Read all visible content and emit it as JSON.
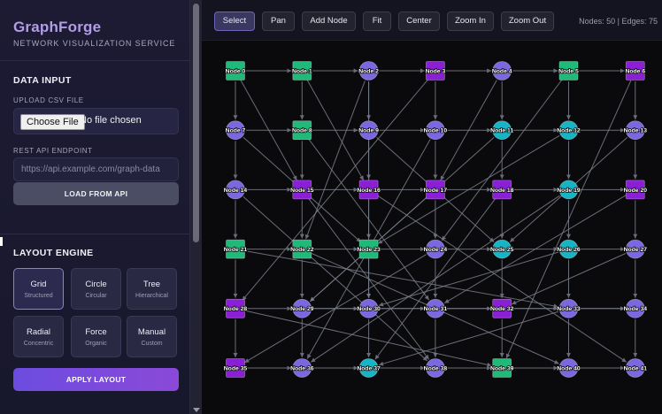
{
  "sidebar": {
    "brand": "GraphForge",
    "subtitle": "NETWORK VISUALIZATION SERVICE",
    "data_input": {
      "title": "DATA INPUT",
      "upload_label": "UPLOAD CSV FILE",
      "file_button": "Choose File",
      "file_status": "No file chosen",
      "api_label": "REST API ENDPOINT",
      "api_placeholder": "https://api.example.com/graph-data",
      "load_button": "LOAD FROM API"
    },
    "layout_engine": {
      "title": "LAYOUT ENGINE",
      "options": [
        {
          "name": "Grid",
          "sub": "Structured",
          "active": true
        },
        {
          "name": "Circle",
          "sub": "Circular",
          "active": false
        },
        {
          "name": "Tree",
          "sub": "Hierarchical",
          "active": false
        },
        {
          "name": "Radial",
          "sub": "Concentric",
          "active": false
        },
        {
          "name": "Force",
          "sub": "Organic",
          "active": false
        },
        {
          "name": "Manual",
          "sub": "Custom",
          "active": false
        }
      ],
      "apply_button": "APPLY LAYOUT"
    }
  },
  "toolbar": {
    "buttons": [
      "Select",
      "Pan",
      "Add Node",
      "Fit",
      "Center",
      "Zoom In",
      "Zoom Out"
    ],
    "active": "Select",
    "stats": "Nodes: 50 | Edges: 75"
  },
  "colors": {
    "circle_purple": "#7b68e0",
    "square_violet": "#8a1fd6",
    "square_green": "#1fb97a",
    "circle_cyan": "#16b4c4",
    "edge": "#7a7f8c"
  },
  "graph": {
    "nodes": [
      {
        "label": "Node 0",
        "shape": "square",
        "color": "square_green"
      },
      {
        "label": "Node 1",
        "shape": "square",
        "color": "square_green"
      },
      {
        "label": "Node 2",
        "shape": "circle",
        "color": "circle_purple"
      },
      {
        "label": "Node 3",
        "shape": "square",
        "color": "square_violet"
      },
      {
        "label": "Node 4",
        "shape": "circle",
        "color": "circle_purple"
      },
      {
        "label": "Node 5",
        "shape": "square",
        "color": "square_green"
      },
      {
        "label": "Node 6",
        "shape": "square",
        "color": "square_violet"
      },
      {
        "label": "Node 7",
        "shape": "circle",
        "color": "circle_purple"
      },
      {
        "label": "Node 8",
        "shape": "square",
        "color": "square_green"
      },
      {
        "label": "Node 9",
        "shape": "circle",
        "color": "circle_purple"
      },
      {
        "label": "Node 10",
        "shape": "circle",
        "color": "circle_purple"
      },
      {
        "label": "Node 11",
        "shape": "circle",
        "color": "circle_cyan"
      },
      {
        "label": "Node 12",
        "shape": "circle",
        "color": "circle_cyan"
      },
      {
        "label": "Node 13",
        "shape": "circle",
        "color": "circle_purple"
      },
      {
        "label": "Node 14",
        "shape": "circle",
        "color": "circle_purple"
      },
      {
        "label": "Node 15",
        "shape": "square",
        "color": "square_violet"
      },
      {
        "label": "Node 16",
        "shape": "square",
        "color": "square_violet"
      },
      {
        "label": "Node 17",
        "shape": "square",
        "color": "square_violet"
      },
      {
        "label": "Node 18",
        "shape": "square",
        "color": "square_violet"
      },
      {
        "label": "Node 19",
        "shape": "circle",
        "color": "circle_cyan"
      },
      {
        "label": "Node 20",
        "shape": "square",
        "color": "square_violet"
      },
      {
        "label": "Node 21",
        "shape": "square",
        "color": "square_green"
      },
      {
        "label": "Node 22",
        "shape": "square",
        "color": "square_green"
      },
      {
        "label": "Node 23",
        "shape": "square",
        "color": "square_green"
      },
      {
        "label": "Node 24",
        "shape": "circle",
        "color": "circle_purple"
      },
      {
        "label": "Node 25",
        "shape": "circle",
        "color": "circle_cyan"
      },
      {
        "label": "Node 26",
        "shape": "circle",
        "color": "circle_cyan"
      },
      {
        "label": "Node 27",
        "shape": "circle",
        "color": "circle_purple"
      },
      {
        "label": "Node 28",
        "shape": "square",
        "color": "square_violet"
      },
      {
        "label": "Node 29",
        "shape": "circle",
        "color": "circle_purple"
      },
      {
        "label": "Node 30",
        "shape": "circle",
        "color": "circle_purple"
      },
      {
        "label": "Node 31",
        "shape": "circle",
        "color": "circle_purple"
      },
      {
        "label": "Node 32",
        "shape": "square",
        "color": "square_violet"
      },
      {
        "label": "Node 33",
        "shape": "circle",
        "color": "circle_purple"
      },
      {
        "label": "Node 34",
        "shape": "circle",
        "color": "circle_purple"
      },
      {
        "label": "Node 35",
        "shape": "square",
        "color": "square_violet"
      },
      {
        "label": "Node 36",
        "shape": "circle",
        "color": "circle_purple"
      },
      {
        "label": "Node 37",
        "shape": "circle",
        "color": "circle_cyan"
      },
      {
        "label": "Node 38",
        "shape": "circle",
        "color": "circle_purple"
      },
      {
        "label": "Node 39",
        "shape": "square",
        "color": "square_green"
      },
      {
        "label": "Node 40",
        "shape": "circle",
        "color": "circle_purple"
      },
      {
        "label": "Node 41",
        "shape": "circle",
        "color": "circle_purple"
      }
    ],
    "edges": [
      [
        0,
        1
      ],
      [
        1,
        2
      ],
      [
        2,
        3
      ],
      [
        3,
        4
      ],
      [
        4,
        5
      ],
      [
        5,
        6
      ],
      [
        7,
        8
      ],
      [
        8,
        9
      ],
      [
        9,
        10
      ],
      [
        10,
        11
      ],
      [
        11,
        12
      ],
      [
        12,
        13
      ],
      [
        14,
        15
      ],
      [
        15,
        16
      ],
      [
        16,
        17
      ],
      [
        17,
        18
      ],
      [
        18,
        19
      ],
      [
        19,
        20
      ],
      [
        21,
        22
      ],
      [
        22,
        23
      ],
      [
        23,
        24
      ],
      [
        24,
        25
      ],
      [
        25,
        26
      ],
      [
        26,
        27
      ],
      [
        28,
        29
      ],
      [
        29,
        30
      ],
      [
        30,
        31
      ],
      [
        31,
        32
      ],
      [
        32,
        33
      ],
      [
        33,
        34
      ],
      [
        35,
        36
      ],
      [
        36,
        37
      ],
      [
        37,
        38
      ],
      [
        38,
        39
      ],
      [
        39,
        40
      ],
      [
        40,
        41
      ],
      [
        0,
        7
      ],
      [
        7,
        14
      ],
      [
        14,
        21
      ],
      [
        21,
        28
      ],
      [
        28,
        35
      ],
      [
        1,
        8
      ],
      [
        8,
        15
      ],
      [
        15,
        22
      ],
      [
        22,
        29
      ],
      [
        29,
        36
      ],
      [
        2,
        9
      ],
      [
        9,
        16
      ],
      [
        16,
        23
      ],
      [
        23,
        30
      ],
      [
        30,
        37
      ],
      [
        3,
        10
      ],
      [
        10,
        17
      ],
      [
        17,
        24
      ],
      [
        24,
        31
      ],
      [
        31,
        38
      ],
      [
        4,
        11
      ],
      [
        11,
        18
      ],
      [
        18,
        25
      ],
      [
        25,
        32
      ],
      [
        32,
        39
      ],
      [
        5,
        12
      ],
      [
        12,
        19
      ],
      [
        19,
        26
      ],
      [
        26,
        33
      ],
      [
        33,
        40
      ],
      [
        6,
        13
      ],
      [
        13,
        20
      ],
      [
        20,
        27
      ],
      [
        27,
        34
      ],
      [
        34,
        41
      ],
      [
        1,
        16
      ],
      [
        2,
        30
      ],
      [
        3,
        28
      ],
      [
        5,
        24
      ],
      [
        6,
        39
      ],
      [
        8,
        31
      ],
      [
        9,
        25
      ],
      [
        10,
        36
      ],
      [
        12,
        23
      ],
      [
        15,
        38
      ],
      [
        16,
        41
      ],
      [
        17,
        29
      ],
      [
        18,
        37
      ],
      [
        21,
        33
      ],
      [
        22,
        40
      ],
      [
        24,
        35
      ],
      [
        26,
        30
      ],
      [
        27,
        32
      ],
      [
        28,
        39
      ],
      [
        29,
        34
      ],
      [
        2,
        22
      ],
      [
        4,
        17
      ],
      [
        11,
        29
      ],
      [
        13,
        25
      ],
      [
        19,
        36
      ],
      [
        20,
        31
      ],
      [
        14,
        38
      ],
      [
        7,
        23
      ],
      [
        0,
        15
      ],
      [
        33,
        37
      ]
    ]
  }
}
